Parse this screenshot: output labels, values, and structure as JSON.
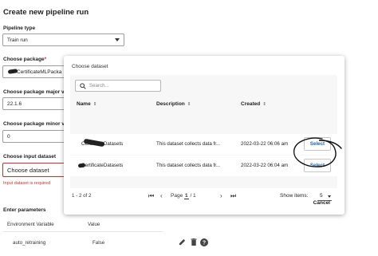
{
  "page": {
    "title": "Create new pipeline run",
    "pipeline_type": {
      "label": "Pipeline type",
      "value": "Train run"
    },
    "package": {
      "label": "Choose package",
      "required_mark": "*",
      "value": "CertificateMLPacka"
    },
    "package_major": {
      "label": "Choose package major v",
      "value": "22.1.6"
    },
    "package_minor": {
      "label": "Choose package minor v",
      "value": "0"
    },
    "input_dataset": {
      "label": "Choose input dataset",
      "value": "Choose dataset",
      "error": "Input dataset is required"
    },
    "parameters": {
      "title": "Enter parameters",
      "headers": {
        "variable": "Environment Variable",
        "value": "Value"
      },
      "rows": [
        {
          "variable": "auto_retraining",
          "value": "False"
        }
      ]
    }
  },
  "modal": {
    "title": "Choose dataset",
    "search_placeholder": "Search...",
    "columns": {
      "name": "Name",
      "description": "Description",
      "created": "Created",
      "sort_glyph": "⇕"
    },
    "rows": [
      {
        "name": "CertificateDatasets",
        "description": "This dataset collects data fr...",
        "created": "2022-03-22 06:06 am",
        "action": "Select"
      },
      {
        "name": "CertificateDatasets",
        "description": "This dataset collects data fr...",
        "created": "2022-03-22 06:04 am",
        "action": "Select"
      }
    ],
    "pagination": {
      "range": "1 - 2 of 2",
      "page_label": "Page",
      "page": "1",
      "total": "/ 1",
      "show_items_label": "Show items:",
      "show_items_value": "5"
    },
    "cancel_label": "Cancel"
  },
  "colors": {
    "accent": "#1565c0",
    "error": "#d32f2f",
    "annotation": "#111111"
  },
  "icons": [
    "search-icon",
    "sort-icon",
    "first-page-icon",
    "prev-page-icon",
    "next-page-icon",
    "last-page-icon",
    "edit-icon",
    "delete-icon",
    "help-icon"
  ]
}
